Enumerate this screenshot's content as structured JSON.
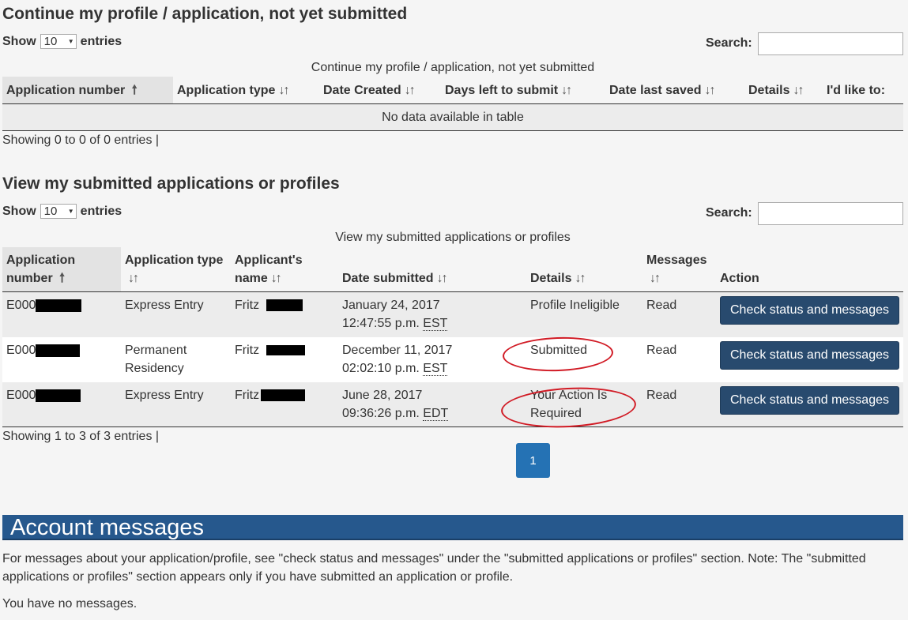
{
  "section1": {
    "title": "Continue my profile / application, not yet submitted",
    "show_label": "Show",
    "show_value": "10",
    "entries_label": "entries",
    "search_label": "Search:",
    "search_value": "",
    "caption": "Continue my profile / application, not yet submitted",
    "columns": [
      "Application number",
      "Application type",
      "Date Created",
      "Days left to submit",
      "Date last saved",
      "Details",
      "I'd like to:"
    ],
    "empty_text": "No data available in table",
    "info": "Showing 0 to 0 of 0 entries |"
  },
  "section2": {
    "title": "View my submitted applications or profiles",
    "show_label": "Show",
    "show_value": "10",
    "entries_label": "entries",
    "search_label": "Search:",
    "search_value": "",
    "caption": "View my submitted applications or profiles",
    "columns": {
      "app_number_1": "Application",
      "app_number_2": "number",
      "app_type": "Application type",
      "name_1": "Applicant's",
      "name_2": "name",
      "date": "Date submitted",
      "details": "Details",
      "messages": "Messages",
      "action": "Action"
    },
    "rows": [
      {
        "app_prefix": "E000",
        "type_1": "Express Entry",
        "type_2": "",
        "name": "Fritz",
        "date_1": "January 24, 2017",
        "date_2": "12:47:55 p.m.",
        "tz": "EST",
        "details_1": "Profile Ineligible",
        "details_2": "",
        "messages": "Read",
        "action": "Check status and messages"
      },
      {
        "app_prefix": "E000",
        "type_1": "Permanent",
        "type_2": "Residency",
        "name": "Fritz",
        "date_1": "December 11, 2017",
        "date_2": "02:02:10 p.m.",
        "tz": "EST",
        "details_1": "Submitted",
        "details_2": "",
        "messages": "Read",
        "action": "Check status and messages"
      },
      {
        "app_prefix": "E000",
        "type_1": "Express Entry",
        "type_2": "",
        "name": "Fritz",
        "date_1": "June 28, 2017",
        "date_2": "09:36:26 p.m.",
        "tz": "EDT",
        "details_1": "Your Action Is",
        "details_2": "Required",
        "messages": "Read",
        "action": "Check status and messages"
      }
    ],
    "info": "Showing 1 to 3 of 3 entries |",
    "page": "1"
  },
  "account": {
    "title": "Account messages",
    "note_1": "For messages about your application/profile, see \"check status and messages\" under the \"submitted applications or profiles\" section. Note: The \"submitted",
    "note_2": "applications or profiles\" section appears only if you have submitted an application or profile.",
    "no_messages": "You have no messages."
  },
  "colors": {
    "button": "#284a6e",
    "banner": "#26588d",
    "page_button": "#2572b4",
    "annotation": "#d11b25"
  }
}
